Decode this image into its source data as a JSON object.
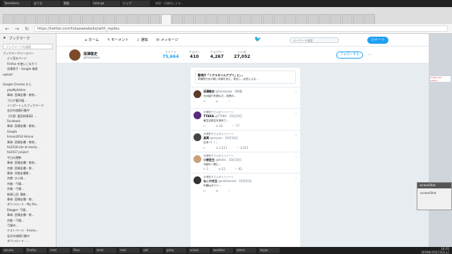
{
  "os_bar": {
    "tabs": [
      "Tweetdeck",
      "はてな",
      "電脳",
      "tank-ga",
      "トップ"
    ],
    "title": "産経・古森氏による..."
  },
  "browser": {
    "tab_count": 33,
    "url": "https://twitter.com/fukazawakeiko/with_replies",
    "back": "←",
    "forward": "→",
    "reload": "↻"
  },
  "sidebar": {
    "title": "ブックマーク",
    "search_placeholder": "ブックマークを検索",
    "items": [
      {
        "label": "ブックマークツールバー",
        "folder": true
      },
      {
        "label": "よく見るページ",
        "folder": false
      },
      {
        "label": "Firefox を使いこなそう",
        "folder": false
      },
      {
        "label": "深澤恵子 - Google 検索",
        "folder": false
      },
      {
        "label": "upload",
        "folder": true
      },
      {
        "label": "",
        "folder": false
      },
      {
        "label": "Google Chrome から",
        "folder": true
      },
      {
        "label": "phpMyAdmin",
        "folder": false
      },
      {
        "label": "華林: 西陣金襴・帯地...",
        "folder": false
      },
      {
        "label": "ブログ著作権...",
        "folder": false
      },
      {
        "label": "インポートしたブックマーク",
        "folder": false
      },
      {
        "label": "金沢市旅館行動中",
        "folder": false
      },
      {
        "label": "【大阪: 富田林東高】...",
        "folder": false
      },
      {
        "label": "Facebook",
        "folder": false
      },
      {
        "label": "華林: 西陣金襴・帯地...",
        "folder": false
      },
      {
        "label": "Google",
        "folder": false
      },
      {
        "label": "hirono2014 Hirono",
        "folder": false
      },
      {
        "label": "華林: 西陣金襴・帯地...",
        "folder": false
      },
      {
        "label": "hk2018 site at mesia...",
        "folder": false
      },
      {
        "label": "hk2017 project",
        "folder": false
      },
      {
        "label": "今日の運勢",
        "folder": false
      },
      {
        "label": "華林: 西陣金襴・帯地...",
        "folder": false
      },
      {
        "label": "京都: 西陣金襴・帯...",
        "folder": false
      },
      {
        "label": "華林: 京都金襴帯...",
        "folder": false
      },
      {
        "label": "京都: ひら鉢...",
        "folder": false
      },
      {
        "label": "京美・弓場...",
        "folder": false
      },
      {
        "label": "京美・弓場...",
        "folder": false
      },
      {
        "label": "新規上田: 最新...",
        "folder": false
      },
      {
        "label": "華林: 西陣金襴・帯...",
        "folder": false
      },
      {
        "label": "ダウンロード - My Pro...",
        "folder": false
      },
      {
        "label": "Blogger: 弓場...",
        "folder": false
      },
      {
        "label": "華林: 西陣金襴・帯...",
        "folder": false
      },
      {
        "label": "京都・弓場...",
        "folder": false
      },
      {
        "label": "弓場市...",
        "folder": false
      },
      {
        "label": "テストページ - hirono...",
        "folder": false
      },
      {
        "label": "金沢市旅館行動中",
        "folder": false
      },
      {
        "label": "ダウンロード - ...",
        "folder": false
      }
    ]
  },
  "twitter": {
    "nav": [
      "ホーム",
      "モーメント",
      "通知",
      "メッセージ"
    ],
    "search_placeholder": "キーワード検索",
    "tweet_button": "ツイート",
    "profile": {
      "name": "深澤敬史",
      "handle": "@fukazawa",
      "follow_label": "フォローする",
      "more": "⋯"
    },
    "stats": [
      {
        "label": "ツイート",
        "value": "75,664"
      },
      {
        "label": "フォロー",
        "value": "410"
      },
      {
        "label": "フォロワー",
        "value": "4,267"
      },
      {
        "label": "いいね",
        "value": "27,052"
      }
    ],
    "quote": {
      "title": "警視庁「リアルタイムアプリ」に...",
      "body": "参議院元女の粗い本論を含む、見出し...女性による..."
    },
    "tweets": [
      {
        "context": "",
        "name": "深澤敬史",
        "handle": "@fukazawa · 3時間",
        "text": "元の紹介を読んだ。自然の...",
        "avatar": "#5a3a2a",
        "actions": [
          "↩",
          "⟲",
          "♡"
        ]
      },
      {
        "context": "深澤恵子さんがリツイート",
        "name": "T-TAKA",
        "handle": "@TTAKA · 10月10日",
        "text": "東生法改正を求めて...",
        "avatar": "#5a2a7a",
        "actions": [
          "↩",
          "⟲ 33",
          "♡ 77"
        ]
      },
      {
        "context": "深澤恵子さんがリツイート",
        "name": "真実",
        "handle": "@mysun · 10月10日",
        "text": "日本ー！！...",
        "avatar": "#444",
        "actions": [
          "↩",
          "⟲ 1,211",
          "♡ 2,011"
        ]
      },
      {
        "context": "深澤恵子さんがリツイート",
        "name": "小野匠生",
        "handle": "@Hotei · 10月10日",
        "text": "今回の一般に...",
        "avatar": "#c9a07a",
        "actions": [
          "↩ 1",
          "⟲ 23",
          "♡ 62"
        ]
      },
      {
        "context": "深澤恵子さんがリツイート",
        "name": "ねこの先生",
        "handle": "@nekosense · 10月10日",
        "text": "中継はボツリ...",
        "avatar": "#333",
        "actions": [
          "↩",
          "⟲",
          "♡"
        ]
      }
    ]
  },
  "right_pane": {
    "snippet": "cmdb mail (reply)..."
  },
  "popup": {
    "title": "screenShot",
    "body": "screenShot"
  },
  "taskbar": {
    "items": [
      "ubuntu",
      "Firefox",
      "cmd",
      "Files",
      "term",
      "mail",
      "ubt",
      "gimp",
      "xclock",
      "weather",
      "xterm",
      "skype"
    ],
    "time": "14:31",
    "date": "2018年10月13日(土)"
  }
}
